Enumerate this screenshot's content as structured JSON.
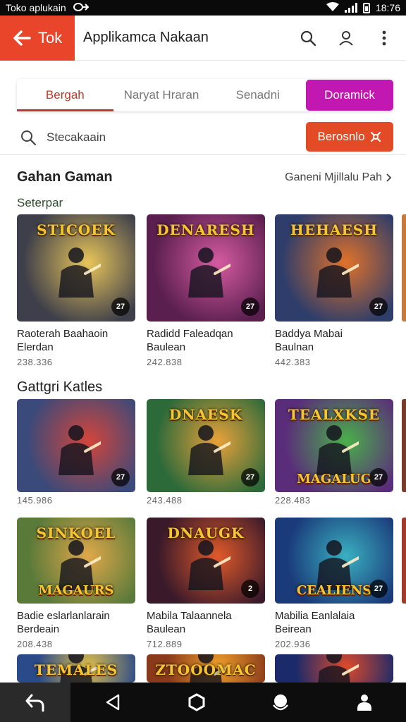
{
  "status_bar": {
    "left_text": "Toko aplukain",
    "time": "18:76"
  },
  "app_bar": {
    "back_label": "Tok",
    "title": "Applikamca Nakaan"
  },
  "tabs": [
    {
      "label": "Bergah",
      "active": true
    },
    {
      "label": "Naryat Hraran",
      "active": false
    },
    {
      "label": "Senadni",
      "active": false
    },
    {
      "label": "Doramick",
      "active": false
    }
  ],
  "search": {
    "placeholder": "Stecakaain",
    "button_label": "Berosnlo"
  },
  "section1": {
    "title": "Gahan Gaman",
    "link": "Ganeni Mjillalu Pah",
    "subtitle": "Seterpar",
    "cards": [
      {
        "logo": "STICOEK",
        "name_line1": "Raoterah Baahaoin",
        "name_line2": "Elerdan",
        "count": "238.336",
        "badge": "27",
        "colors": [
          "#3e3f4a",
          "#e8c55a"
        ]
      },
      {
        "logo": "DENARESH",
        "name_line1": "Radidd Faleadqan",
        "name_line2": "Baulean",
        "count": "242.838",
        "badge": "27",
        "colors": [
          "#5a1f4f",
          "#d55ba0"
        ]
      },
      {
        "logo": "HEHAESH",
        "name_line1": "Baddya Mabai",
        "name_line2": "Baulnan",
        "count": "442.383",
        "badge": "27",
        "colors": [
          "#2e3d6a",
          "#e0722a"
        ]
      }
    ]
  },
  "section2": {
    "title": "Gattgri Katles",
    "row1": [
      {
        "logo": "",
        "name_line1": "",
        "name_line2": "",
        "count": "145.986",
        "badge": "27",
        "colors": [
          "#3a4a7a",
          "#d4453a"
        ]
      },
      {
        "logo": "DNAESK",
        "name_line1": "",
        "name_line2": "",
        "count": "243.488",
        "badge": "27",
        "colors": [
          "#2d6a3a",
          "#e8a13a"
        ]
      },
      {
        "logo": "TEALXKSE",
        "logo2": "MAGALUG",
        "name_line1": "",
        "name_line2": "",
        "count": "228.483",
        "badge": "27",
        "colors": [
          "#5a2d7a",
          "#4ab04a"
        ]
      }
    ],
    "row2": [
      {
        "logo": "SINKOEL",
        "logo2": "MAGAURS",
        "name_line1": "Badie eslarlanlarain",
        "name_line2": "Berdeain",
        "count": "208.438",
        "badge": "",
        "colors": [
          "#5a7a3a",
          "#e0a84a"
        ]
      },
      {
        "logo": "DNAUGK",
        "name_line1": "Mabila Talaannela",
        "name_line2": "Baulean",
        "count": "712.889",
        "badge": "2",
        "colors": [
          "#3a1a2a",
          "#e05a2a"
        ]
      },
      {
        "logo": "",
        "logo2": "CEALIENS",
        "name_line1": "Mabilia Eanlalaia",
        "name_line2": "Beirean",
        "count": "202.936",
        "badge": "27",
        "colors": [
          "#1a3a7a",
          "#3ab0c0"
        ]
      }
    ],
    "row3": [
      {
        "logo": "TEMALES",
        "colors": [
          "#2a4a8a",
          "#e0c04a"
        ]
      },
      {
        "logo": "ZTOOOMAC",
        "colors": [
          "#8a3a1a",
          "#f0a02a"
        ]
      },
      {
        "logo": "",
        "colors": [
          "#1a2a6a",
          "#e04a2a"
        ]
      }
    ]
  },
  "nav_icons": [
    "back-gesture-icon",
    "nav-back-icon",
    "nav-home-icon",
    "nav-assistant-icon",
    "nav-profile-icon"
  ],
  "accent": "#e8452a",
  "tab_cta_color": "#c018b0"
}
